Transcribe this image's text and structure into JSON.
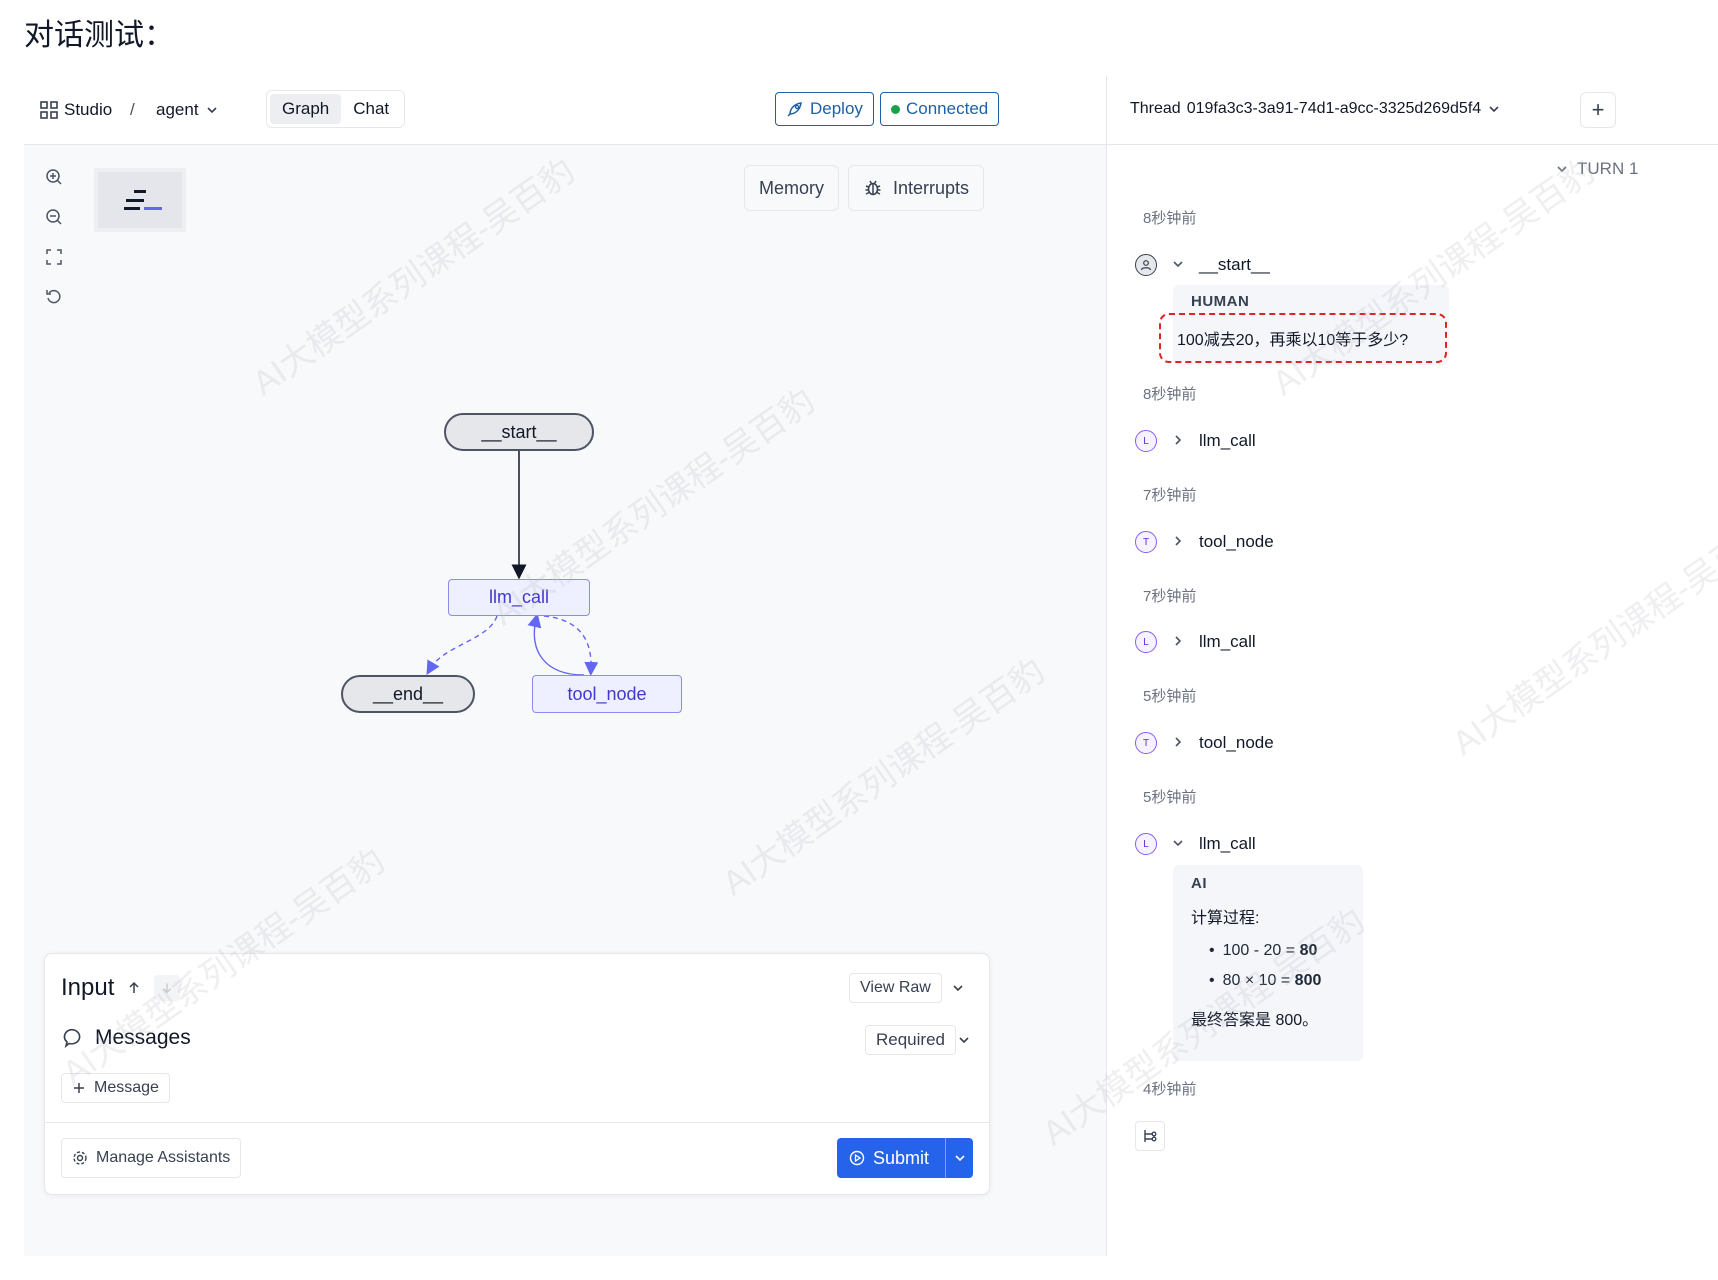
{
  "doc_heading": "对话测试：",
  "topbar": {
    "studio_label": "Studio",
    "breadcrumb_sep": "/",
    "agent_label": "agent",
    "tabs": [
      {
        "label": "Graph"
      },
      {
        "label": "Chat"
      }
    ],
    "deploy_label": "Deploy",
    "connected_label": "Connected",
    "thread_label": "Thread",
    "thread_id": "019fa3c3-3a91-74d1-a9cc-3325d269d5f4",
    "add_label": "+"
  },
  "canvas": {
    "memory_label": "Memory",
    "interrupts_label": "Interrupts",
    "nodes": {
      "start": "__start__",
      "llm_call": "llm_call",
      "end": "__end__",
      "tool_node": "tool_node"
    }
  },
  "input_panel": {
    "title": "Input",
    "view_raw": "View Raw",
    "messages_label": "Messages",
    "required_label": "Required",
    "add_message": "Message",
    "manage_assistants": "Manage Assistants",
    "submit": "Submit"
  },
  "timeline": {
    "turn_label": "TURN 1",
    "entries": [
      {
        "time": "8秒钟前",
        "badge": "",
        "node": "__start__"
      },
      {
        "time": "8秒钟前",
        "badge": "L",
        "node": "llm_call"
      },
      {
        "time": "7秒钟前",
        "badge": "T",
        "node": "tool_node"
      },
      {
        "time": "7秒钟前",
        "badge": "L",
        "node": "llm_call"
      },
      {
        "time": "5秒钟前",
        "badge": "T",
        "node": "tool_node"
      },
      {
        "time": "5秒钟前",
        "badge": "L",
        "node": "llm_call"
      },
      {
        "time": "4秒钟前"
      }
    ],
    "human": {
      "role": "HUMAN",
      "text": "100减去20，再乘以10等于多少?"
    },
    "ai": {
      "role": "AI",
      "heading": "计算过程:",
      "bullets": [
        {
          "expr": "100 - 20 = ",
          "result": "80"
        },
        {
          "expr": "80 × 10 = ",
          "result": "800"
        }
      ],
      "final": "最终答案是 800。"
    }
  },
  "watermark_text": "AI大模型系列课程-吴百豹"
}
